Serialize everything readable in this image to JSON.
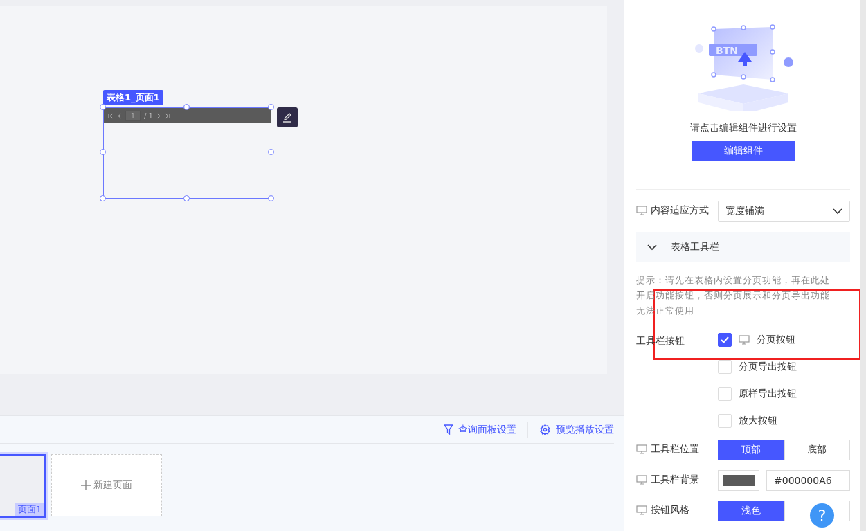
{
  "canvas": {
    "component": {
      "label": "表格1_页面1",
      "selected": true,
      "page_value": "1",
      "page_total": "/ 1"
    }
  },
  "bottom_bar": {
    "links": [
      {
        "label": "查询面板设置",
        "kind": "filter"
      },
      {
        "label": "预览播放设置",
        "kind": "gear"
      }
    ],
    "pages": [
      {
        "label": "页面1",
        "selected": true
      }
    ],
    "new_page": "新建页面"
  },
  "panel": {
    "illustration_text": "BTN",
    "hint": "请点击编辑组件进行设置",
    "edit_button": "编辑组件",
    "fit": {
      "label": "内容适应方式",
      "value": "宽度铺满"
    },
    "section": {
      "title": "表格工具栏",
      "expanded": true
    },
    "tip": "提示：请先在表格内设置分页功能，再在此处开启功能按钮，否则分页展示和分页导出功能无法正常使用",
    "toolbar_buttons": {
      "label": "工具栏按钮",
      "options": [
        {
          "label": "分页按钮",
          "checked": true,
          "kind": "device"
        },
        {
          "label": "分页导出按钮",
          "checked": false,
          "kind": "plain"
        },
        {
          "label": "原样导出按钮",
          "checked": false,
          "kind": "plain"
        },
        {
          "label": "放大按钮",
          "checked": false,
          "kind": "plain"
        }
      ]
    },
    "position": {
      "label": "工具栏位置",
      "options": [
        {
          "label": "顶部",
          "selected": true
        },
        {
          "label": "底部",
          "selected": false
        }
      ]
    },
    "background": {
      "label": "工具栏背景",
      "color": "#5a5a5a",
      "value": "#000000A6"
    },
    "style": {
      "label": "按钮风格",
      "options": [
        {
          "label": "浅色",
          "selected": true
        },
        {
          "selected": false
        }
      ]
    },
    "help": "?"
  }
}
